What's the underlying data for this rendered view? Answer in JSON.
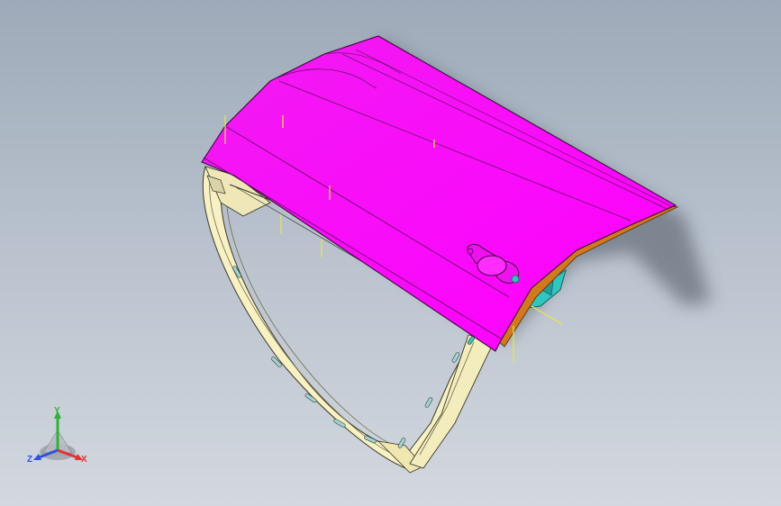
{
  "viewport": {
    "background_top": "#9eaab9",
    "background_bottom": "#d3d8df",
    "model": {
      "panel_color": "#ff00ff",
      "frame_color": "#f7f1c3",
      "bracket_color": "#2ec7c0",
      "edge_color": "#d27a1a",
      "guide_line_color": "#eaea3a"
    }
  },
  "triad": {
    "x_label": "X",
    "y_label": "Y",
    "z_label": "Z",
    "x_color": "#e53232",
    "y_color": "#2fb23b",
    "z_color": "#2e52e0"
  }
}
